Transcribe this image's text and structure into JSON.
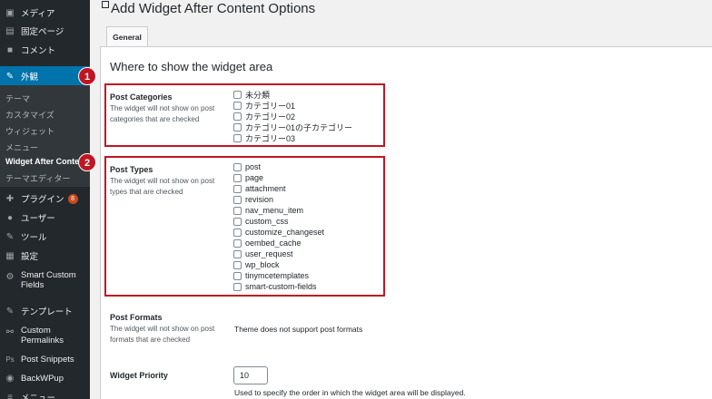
{
  "sidebar": {
    "top_items": [
      {
        "label": "メディア",
        "icon": "media-icon"
      },
      {
        "label": "固定ページ",
        "icon": "pages-icon"
      },
      {
        "label": "コメント",
        "icon": "comments-icon"
      }
    ],
    "active_item": {
      "label": "外観",
      "icon": "appearance-icon"
    },
    "sub_items": [
      "テーマ",
      "カスタマイズ",
      "ウィジェット",
      "メニュー",
      "Widget After Content",
      "テーマエディター"
    ],
    "current_sub_item": "Widget After Content",
    "bottom_items": [
      {
        "label": "プラグイン",
        "icon": "plugins-icon",
        "badge": "8"
      },
      {
        "label": "ユーザー",
        "icon": "users-icon"
      },
      {
        "label": "ツール",
        "icon": "tools-icon"
      },
      {
        "label": "設定",
        "icon": "settings-icon"
      },
      {
        "label": "Smart Custom Fields",
        "icon": "gear-icon"
      },
      {
        "label": "テンプレート",
        "icon": "template-icon"
      },
      {
        "label": "Custom Permalinks",
        "icon": "link-icon"
      },
      {
        "label": "Post Snippets",
        "icon": "ps-icon"
      },
      {
        "label": "BackWPup",
        "icon": "backwpup-icon"
      },
      {
        "label": "メニュー…",
        "icon": "menu-icon"
      }
    ]
  },
  "markers": [
    "1",
    "2"
  ],
  "page": {
    "title": "Add Widget After Content Options",
    "tab": "General",
    "section_title": "Where to show the widget area"
  },
  "post_categories": {
    "title": "Post Categories",
    "description": "The widget will not show on post categories that are checked",
    "options": [
      "未分類",
      "カテゴリー01",
      "カテゴリー02",
      "カテゴリー01の子カテゴリー",
      "カテゴリー03"
    ]
  },
  "post_types": {
    "title": "Post Types",
    "description": "The widget will not show on post types that are checked",
    "options": [
      "post",
      "page",
      "attachment",
      "revision",
      "nav_menu_item",
      "custom_css",
      "customize_changeset",
      "oembed_cache",
      "user_request",
      "wp_block",
      "tinymcetemplates",
      "smart-custom-fields"
    ]
  },
  "post_formats": {
    "title": "Post Formats",
    "description": "The widget will not show on post formats that are checked",
    "message": "Theme does not support post formats"
  },
  "widget_priority": {
    "title": "Widget Priority",
    "value": "10",
    "help": "Used to specify the order in which the widget area will be displayed."
  },
  "colors": {
    "sidebar": "#23282d",
    "active": "#0073aa",
    "highlight": "#c01522"
  }
}
